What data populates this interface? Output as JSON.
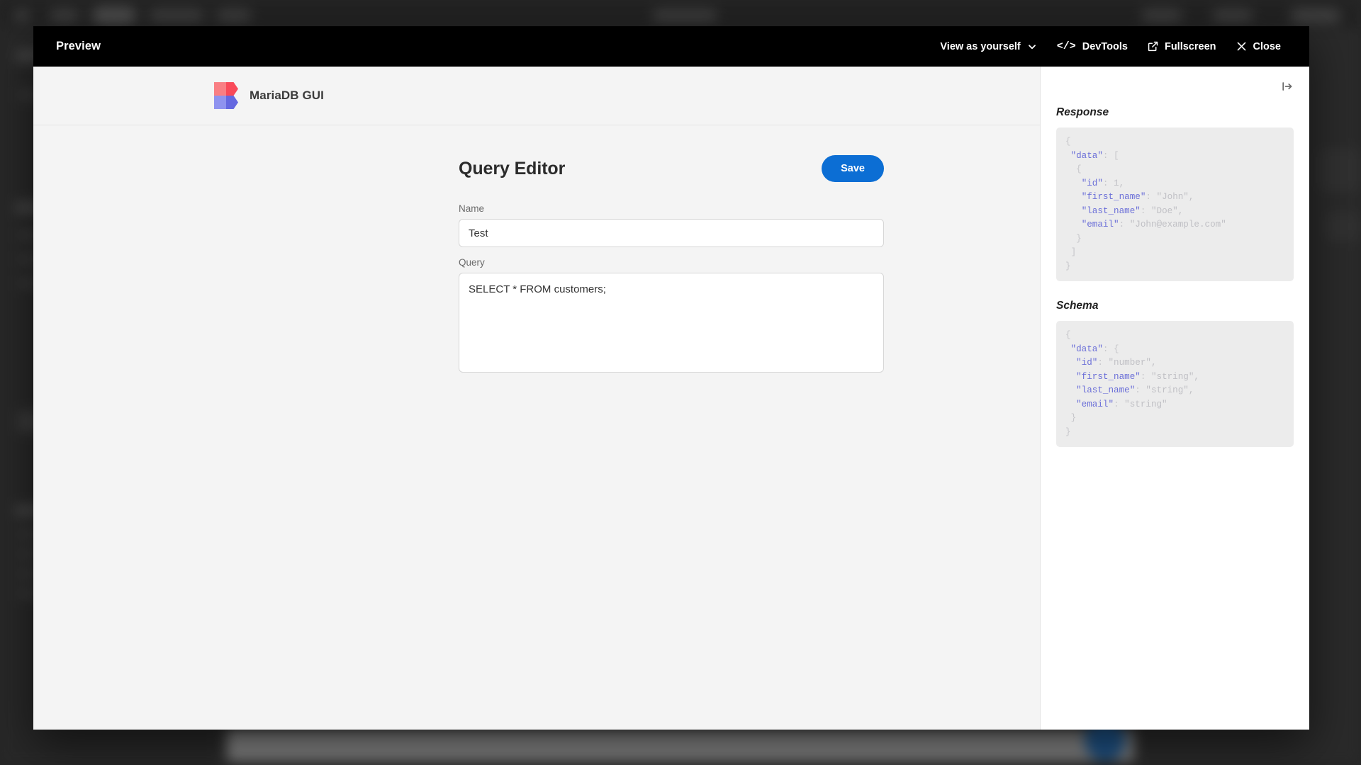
{
  "backdrop": {
    "note": "blurred dark application behind the preview overlay"
  },
  "modal": {
    "title": "Preview",
    "actions": [
      {
        "label": "View as yourself",
        "icon": "chevron-down-icon",
        "name": "view-as-button"
      },
      {
        "label": "DevTools",
        "icon": "code-icon",
        "name": "devtools-button"
      },
      {
        "label": "Fullscreen",
        "icon": "external-link-icon",
        "name": "fullscreen-button"
      },
      {
        "label": "Close",
        "icon": "close-icon",
        "name": "close-button"
      }
    ]
  },
  "app": {
    "brand_name": "MariaDB GUI",
    "logo": {
      "top_left_color": "#f97f84",
      "top_right_color": "#f94a59",
      "bottom_left_color": "#8f93ef",
      "bottom_right_color": "#6568e0"
    },
    "editor": {
      "title": "Query Editor",
      "save_label": "Save",
      "name_label": "Name",
      "name_value": "Test",
      "name_placeholder": "",
      "query_label": "Query",
      "query_value": "SELECT * FROM customers;",
      "query_placeholder": ""
    },
    "accent_color": "#0c6ed4"
  },
  "inspector": {
    "collapse_icon": "collapse-panel-right-icon",
    "response_title": "Response",
    "schema_title": "Schema",
    "response_json": [
      {
        "indent": 0,
        "pun": "{"
      },
      {
        "indent": 1,
        "key": "\"data\"",
        "pun": ": ["
      },
      {
        "indent": 2,
        "pun": "{"
      },
      {
        "indent": 3,
        "key": "\"id\"",
        "pun": ": ",
        "val": "1,"
      },
      {
        "indent": 3,
        "key": "\"first_name\"",
        "pun": ": ",
        "val": "\"John\","
      },
      {
        "indent": 3,
        "key": "\"last_name\"",
        "pun": ": ",
        "val": "\"Doe\","
      },
      {
        "indent": 3,
        "key": "\"email\"",
        "pun": ": ",
        "val": "\"John@example.com\""
      },
      {
        "indent": 2,
        "pun": "}"
      },
      {
        "indent": 1,
        "pun": "]"
      },
      {
        "indent": 0,
        "pun": "}"
      }
    ],
    "schema_json": [
      {
        "indent": 0,
        "pun": "{"
      },
      {
        "indent": 1,
        "key": "\"data\"",
        "pun": ": {"
      },
      {
        "indent": 2,
        "key": "\"id\"",
        "pun": ": ",
        "val": "\"number\","
      },
      {
        "indent": 2,
        "key": "\"first_name\"",
        "pun": ": ",
        "val": "\"string\","
      },
      {
        "indent": 2,
        "key": "\"last_name\"",
        "pun": ": ",
        "val": "\"string\","
      },
      {
        "indent": 2,
        "key": "\"email\"",
        "pun": ": ",
        "val": "\"string\""
      },
      {
        "indent": 1,
        "pun": "}"
      },
      {
        "indent": 0,
        "pun": "}"
      }
    ]
  }
}
